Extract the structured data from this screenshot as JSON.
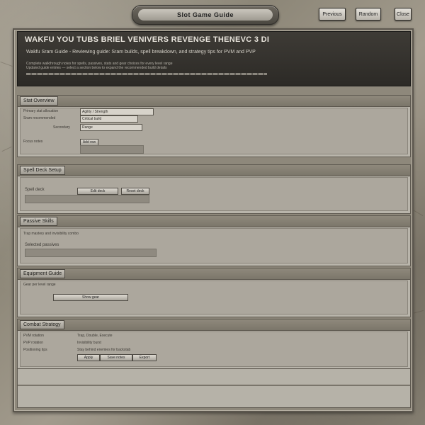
{
  "topbar": {
    "title": "Slot Game Guide",
    "buttons": [
      "Previous",
      "Random",
      "Close"
    ]
  },
  "header": {
    "title": "WAKFU YOU TUBS BRIEL VENIVERS REVENGE THENEVC 3 DI",
    "subtitle": "Wakfu Sram Guide - Reviewing guide: Sram builds, spell breakdown, and strategy tips for PVM and PVP",
    "line1": "Complete walkthrough notes for spells, passives, stats and gear choices for every level range",
    "line2": "Updated guide entries — select a section below to expand the recommended build details"
  },
  "sections": [
    {
      "title": "Stat Overview",
      "rows": [
        {
          "label": "Primary stat allocation",
          "value": "Agility / Strength"
        },
        {
          "label": "Sram recommended",
          "value": "Critical build"
        },
        {
          "label": "Secondary",
          "value": "Range"
        },
        {
          "label": "Focus notes",
          "value": ""
        }
      ],
      "extra": "Add row"
    },
    {
      "title": "Spell Deck Setup",
      "label": "Spell deck",
      "buttons": [
        "Edit deck",
        "Reset deck"
      ]
    },
    {
      "title": "Passive Skills",
      "label": "Selected passives",
      "note": "Trap mastery and invisibility combo"
    },
    {
      "title": "Equipment Guide",
      "label": "Gear per level range",
      "button": "Show gear"
    },
    {
      "title": "Combat Strategy",
      "rows": [
        {
          "label": "PVM rotation",
          "value": "Trap, Double, Execute"
        },
        {
          "label": "PVP rotation",
          "value": "Invisibility burst"
        },
        {
          "label": "Positioning tips",
          "value": "Stay behind enemies for backstab"
        }
      ],
      "buttons": [
        "Apply",
        "Save notes",
        "Export"
      ]
    }
  ]
}
